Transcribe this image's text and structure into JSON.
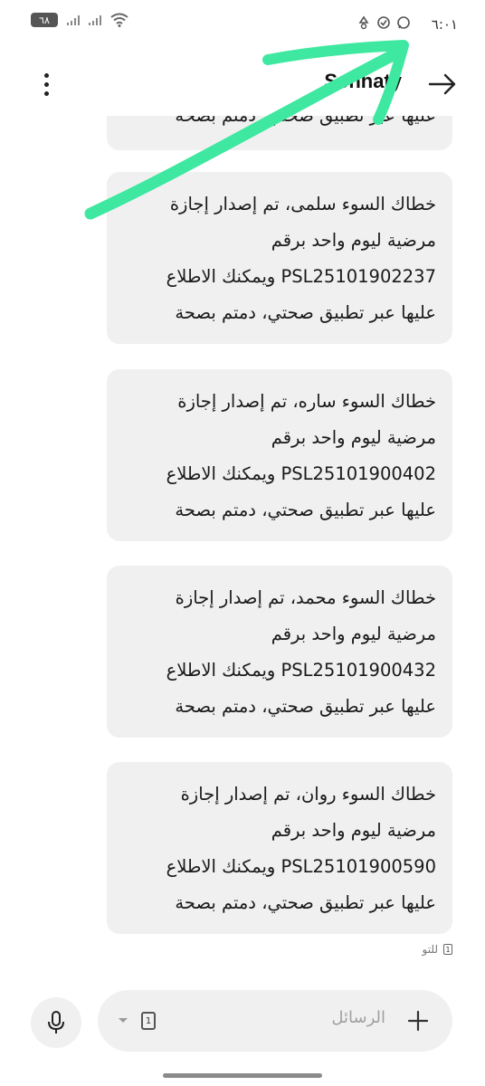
{
  "status_bar": {
    "time": "٦:٠١",
    "battery": "٦٨",
    "icons": [
      "whatsapp-icon",
      "sync-icon",
      "recycle-icon",
      "wifi-icon",
      "signal-icon"
    ]
  },
  "header": {
    "title": "Sehhaty",
    "back_icon": "arrow-right-icon",
    "menu_icon": "more-vertical-icon"
  },
  "messages": [
    {
      "partial": true,
      "lines": [
        "عليها عبر تطبيق صحتي، دمتم بصحة"
      ]
    },
    {
      "lines": [
        "خطاك السوء سلمى، تم إصدار إجازة",
        "مرضية ليوم واحد برقم",
        "PSL25101902237 ويمكنك الاطلاع",
        "عليها عبر تطبيق صحتي، دمتم بصحة"
      ]
    },
    {
      "lines": [
        "خطاك السوء ساره، تم إصدار إجازة",
        "مرضية ليوم واحد برقم",
        "PSL25101900402 ويمكنك الاطلاع",
        "عليها عبر تطبيق صحتي، دمتم بصحة"
      ]
    },
    {
      "lines": [
        "خطاك السوء محمد، تم إصدار إجازة",
        "مرضية ليوم واحد برقم",
        "PSL25101900432 ويمكنك الاطلاع",
        "عليها عبر تطبيق صحتي، دمتم بصحة"
      ]
    },
    {
      "lines": [
        "خطاك السوء روان، تم إصدار إجازة",
        "مرضية ليوم واحد برقم",
        "PSL25101900590 ويمكنك الاطلاع",
        "عليها عبر تطبيق صحتي، دمتم بصحة"
      ]
    }
  ],
  "message_meta": {
    "time": "للتو",
    "sim": "1"
  },
  "compose": {
    "placeholder": "الرسائل",
    "sim": "1",
    "mic_icon": "microphone-icon",
    "plus_icon": "plus-icon",
    "dropdown_icon": "chevron-down-icon"
  },
  "colors": {
    "bubble_bg": "#f0f0f0",
    "annotation_arrow": "#3ee8a0",
    "text": "#1a1a1a",
    "placeholder": "#a0a0a0"
  }
}
